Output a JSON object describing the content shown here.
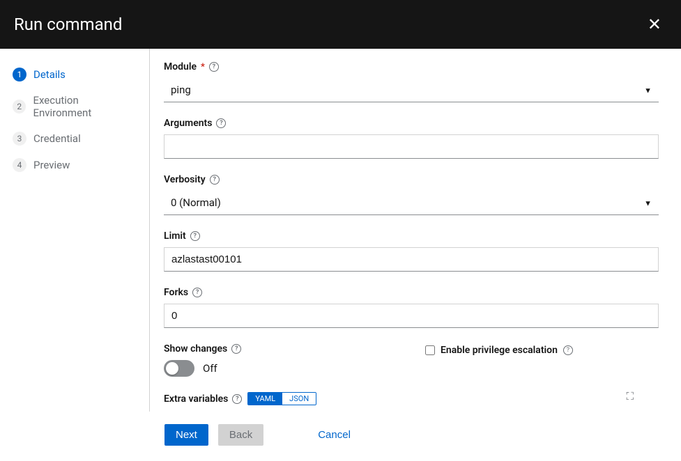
{
  "header": {
    "title": "Run command"
  },
  "steps": [
    {
      "num": "1",
      "label": "Details"
    },
    {
      "num": "2",
      "label": "Execution Environment"
    },
    {
      "num": "3",
      "label": "Credential"
    },
    {
      "num": "4",
      "label": "Preview"
    }
  ],
  "form": {
    "module": {
      "label": "Module",
      "value": "ping"
    },
    "arguments": {
      "label": "Arguments",
      "value": ""
    },
    "verbosity": {
      "label": "Verbosity",
      "value": "0 (Normal)"
    },
    "limit": {
      "label": "Limit",
      "value": "azlastast00101"
    },
    "forks": {
      "label": "Forks",
      "value": "0"
    },
    "show_changes": {
      "label": "Show changes",
      "toggle_text": "Off"
    },
    "privilege": {
      "label": "Enable privilege escalation"
    },
    "extra_vars": {
      "label": "Extra variables",
      "tab_yaml": "YAML",
      "tab_json": "JSON"
    }
  },
  "footer": {
    "next": "Next",
    "back": "Back",
    "cancel": "Cancel"
  }
}
